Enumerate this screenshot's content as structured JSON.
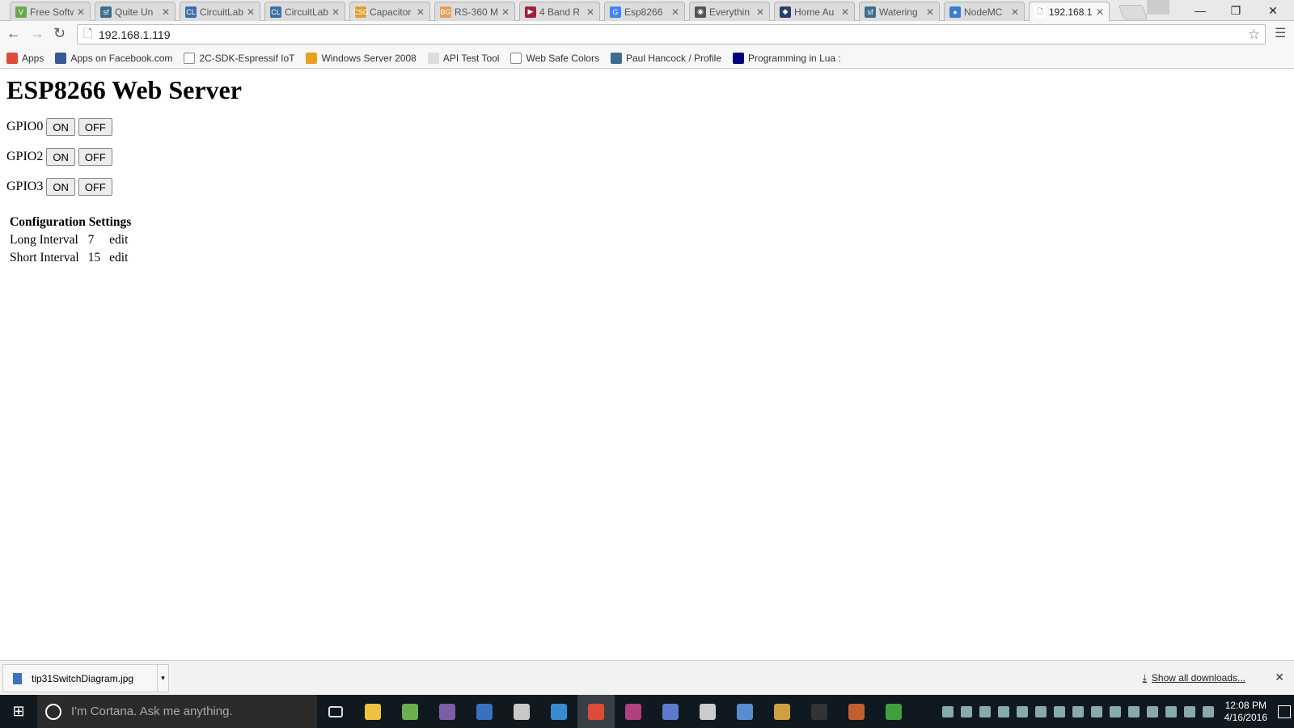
{
  "browser": {
    "tabs": [
      {
        "label": "Free Softw",
        "color": "#6aa84f",
        "glyph": "V"
      },
      {
        "label": "Quite Un",
        "color": "#3d6e8f",
        "glyph": "sf"
      },
      {
        "label": "CircuitLab",
        "color": "#3b6ea5",
        "glyph": "CL"
      },
      {
        "label": "CircuitLab",
        "color": "#3b6ea5",
        "glyph": "CL"
      },
      {
        "label": "Capacitor",
        "color": "#e0a030",
        "glyph": "CSG"
      },
      {
        "label": "RS-360 M",
        "color": "#e69b56",
        "glyph": "BG"
      },
      {
        "label": "4 Band R",
        "color": "#a0203a",
        "glyph": "▶"
      },
      {
        "label": "Esp8266",
        "color": "#4285f4",
        "glyph": "G"
      },
      {
        "label": "Everythin",
        "color": "#555555",
        "glyph": "◉"
      },
      {
        "label": "Home Au",
        "color": "#2c3e6b",
        "glyph": "◆"
      },
      {
        "label": "Watering",
        "color": "#3d6e8f",
        "glyph": "sf"
      },
      {
        "label": "NodeMC",
        "color": "#3a7bd5",
        "glyph": "●"
      },
      {
        "label": "192.168.1",
        "color": "#ffffff",
        "glyph": "🗋",
        "active": true
      }
    ],
    "window_controls": {
      "minimize": "—",
      "restore": "❐",
      "close": "✕"
    },
    "url": "192.168.1.119",
    "bookmarks": [
      {
        "label": "Apps",
        "color": "#e04a3a"
      },
      {
        "label": "Apps on Facebook.com",
        "color": "#3b5998"
      },
      {
        "label": "2C-SDK-Espressif IoT",
        "color": "#ffffff"
      },
      {
        "label": "Windows Server 2008",
        "color": "#e8a020"
      },
      {
        "label": "API Test Tool",
        "color": "#dddddd"
      },
      {
        "label": "Web Safe Colors",
        "color": "#ffffff"
      },
      {
        "label": "Paul Hancock / Profile",
        "color": "#3d6e8f"
      },
      {
        "label": "Programming in Lua :",
        "color": "#000080"
      }
    ]
  },
  "page": {
    "title": "ESP8266 Web Server",
    "gpios": [
      {
        "label": "GPIO0",
        "on": "ON",
        "off": "OFF"
      },
      {
        "label": "GPIO2",
        "on": "ON",
        "off": "OFF"
      },
      {
        "label": "GPIO3",
        "on": "ON",
        "off": "OFF"
      }
    ],
    "config": {
      "heading": "Configuration Settings",
      "rows": [
        {
          "name": "Long Interval",
          "value": "7",
          "action": "edit"
        },
        {
          "name": "Short Interval",
          "value": "15",
          "action": "edit"
        }
      ]
    }
  },
  "downloads": {
    "file": "tip31SwitchDiagram.jpg",
    "show_all": "Show all downloads...",
    "close": "✕"
  },
  "taskbar": {
    "cortana_placeholder": "I'm Cortana. Ask me anything.",
    "apps": [
      "#f0c040",
      "#6ab04c",
      "#7b5ea7",
      "#3a70c0",
      "#c9c9c9",
      "#3a8ad0",
      "#dd4b39",
      "#b04080",
      "#5a7bd0",
      "#cccccc",
      "#5a8cd0",
      "#d0a040",
      "#333333",
      "#c06030",
      "#40a040"
    ],
    "time": "12:08 PM",
    "date": "4/16/2016"
  }
}
